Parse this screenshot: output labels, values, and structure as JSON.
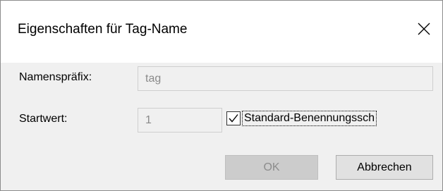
{
  "dialog": {
    "title": "Eigenschaften für Tag-Name",
    "close_icon": "close-icon"
  },
  "form": {
    "prefix_label": "Namenspräfix:",
    "prefix_value": "tag",
    "start_label": "Startwert:",
    "start_value": "1",
    "standard_naming_label": "Standard-Benennungssch",
    "standard_naming_checked": true,
    "check_icon": "checkmark-icon"
  },
  "buttons": {
    "ok_label": "OK",
    "ok_enabled": false,
    "cancel_label": "Abbrechen"
  }
}
